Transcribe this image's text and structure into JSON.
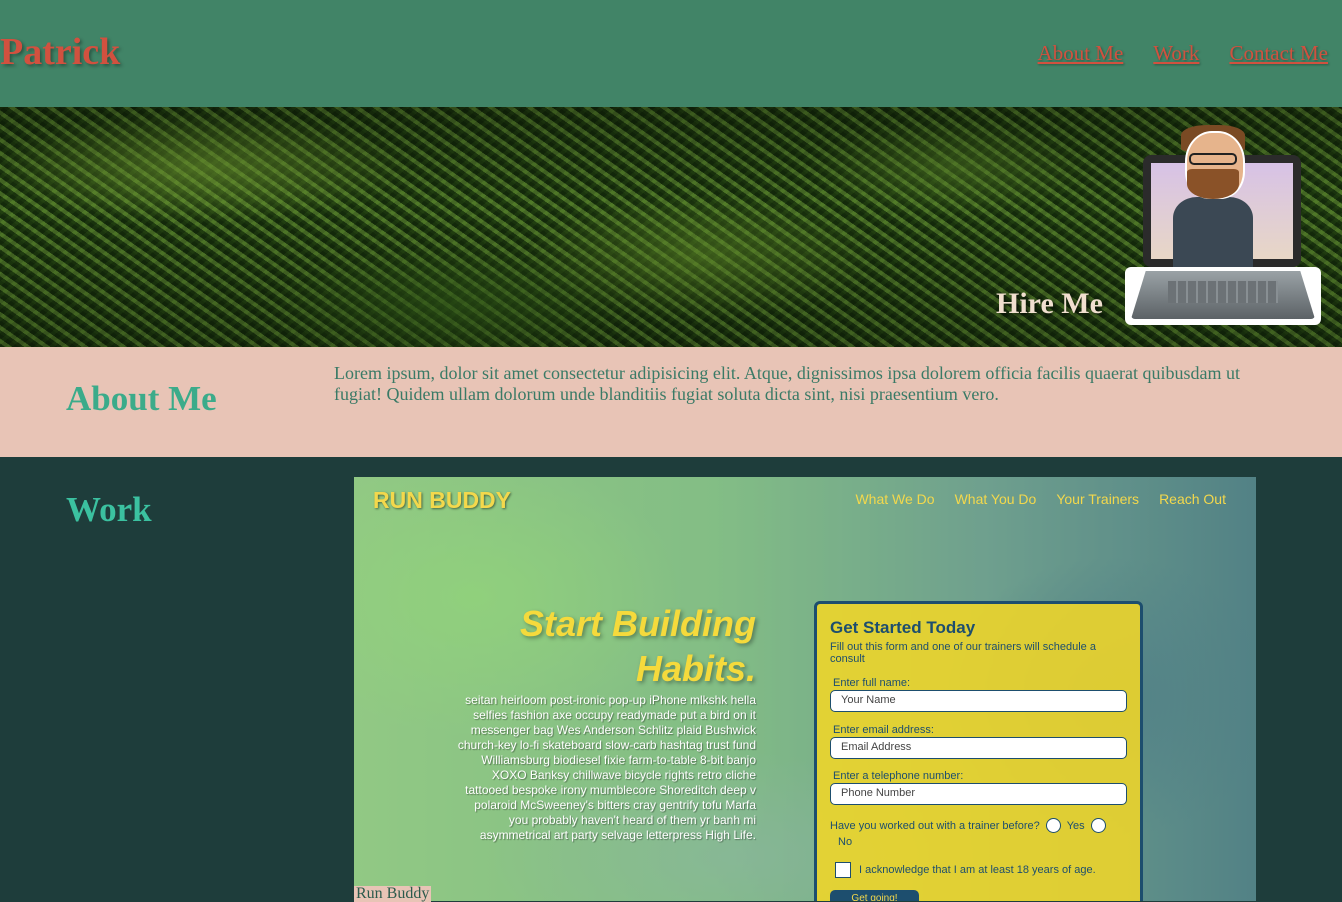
{
  "header": {
    "brand": "Patrick",
    "nav": [
      "About Me",
      "Work",
      "Contact Me"
    ]
  },
  "hero": {
    "hire_label": "Hire Me"
  },
  "about": {
    "heading": "About Me",
    "text": "Lorem ipsum, dolor sit amet consectetur adipisicing elit. Atque, dignissimos ipsa dolorem officia facilis quaerat quibusdam ut fugiat! Quidem ullam dolorum unde blanditiis fugiat soluta dicta sint, nisi praesentium vero."
  },
  "work": {
    "heading": "Work",
    "project": {
      "caption": "Run Buddy",
      "logo": "RUN BUDDY",
      "nav": [
        "What We Do",
        "What You Do",
        "Your Trainers",
        "Reach Out"
      ],
      "headline_line1": "Start Building",
      "headline_line2": "Habits.",
      "copy": "seitan heirloom post-ironic pop-up iPhone mlkshk hella selfies fashion axe occupy readymade put a bird on it messenger bag Wes Anderson Schlitz plaid Bushwick church-key lo-fi skateboard slow-carb hashtag trust fund Williamsburg biodiesel fixie farm-to-table 8-bit banjo XOXO Banksy chillwave bicycle rights retro cliche tattooed bespoke irony mumblecore Shoreditch deep v polaroid McSweeney's bitters cray gentrify tofu Marfa you probably haven't heard of them yr banh mi asymmetrical art party selvage letterpress High Life.",
      "form": {
        "title": "Get Started Today",
        "subtitle": "Fill out this form and one of our trainers will schedule a consult",
        "name_label": "Enter full name:",
        "name_placeholder": "Your Name",
        "email_label": "Enter email address:",
        "email_placeholder": "Email Address",
        "phone_label": "Enter a telephone number:",
        "phone_placeholder": "Phone Number",
        "trainer_question": "Have you worked out with a trainer before?",
        "yes_label": "Yes",
        "no_label": "No",
        "ack_label": "I acknowledge that I am at least 18 years of age.",
        "submit_label": "Get going!"
      }
    }
  },
  "colors": {
    "header_bg": "#418467",
    "brand_red": "#d1513f",
    "about_bg": "#e8c4b6",
    "work_bg": "#1e3d3b",
    "heading_teal": "#3bab8a"
  }
}
